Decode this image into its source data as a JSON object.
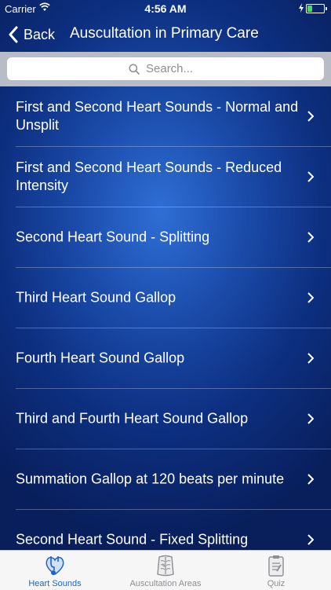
{
  "status_bar": {
    "carrier": "Carrier",
    "time": "4:56 AM",
    "battery_color": "#4cd964"
  },
  "nav": {
    "back_label": "Back",
    "title": "Auscultation in Primary Care"
  },
  "search": {
    "placeholder": "Search..."
  },
  "list": {
    "items": [
      {
        "label": "First and Second Heart Sounds - Normal and Unsplit"
      },
      {
        "label": "First and Second Heart Sounds - Reduced Intensity"
      },
      {
        "label": "Second Heart Sound - Splitting"
      },
      {
        "label": "Third Heart Sound Gallop"
      },
      {
        "label": "Fourth Heart Sound Gallop"
      },
      {
        "label": "Third and Fourth Heart Sound Gallop"
      },
      {
        "label": "Summation Gallop at 120 beats per minute"
      },
      {
        "label": "Second Heart Sound - Fixed Splitting"
      }
    ]
  },
  "tabs": [
    {
      "label": "Heart Sounds",
      "icon": "heart-stethoscope-icon",
      "active": true
    },
    {
      "label": "Auscultation Areas",
      "icon": "chest-icon",
      "active": false
    },
    {
      "label": "Quiz",
      "icon": "clipboard-icon",
      "active": false
    }
  ],
  "colors": {
    "accent": "#1e63c7",
    "background": "#0d2f80"
  }
}
